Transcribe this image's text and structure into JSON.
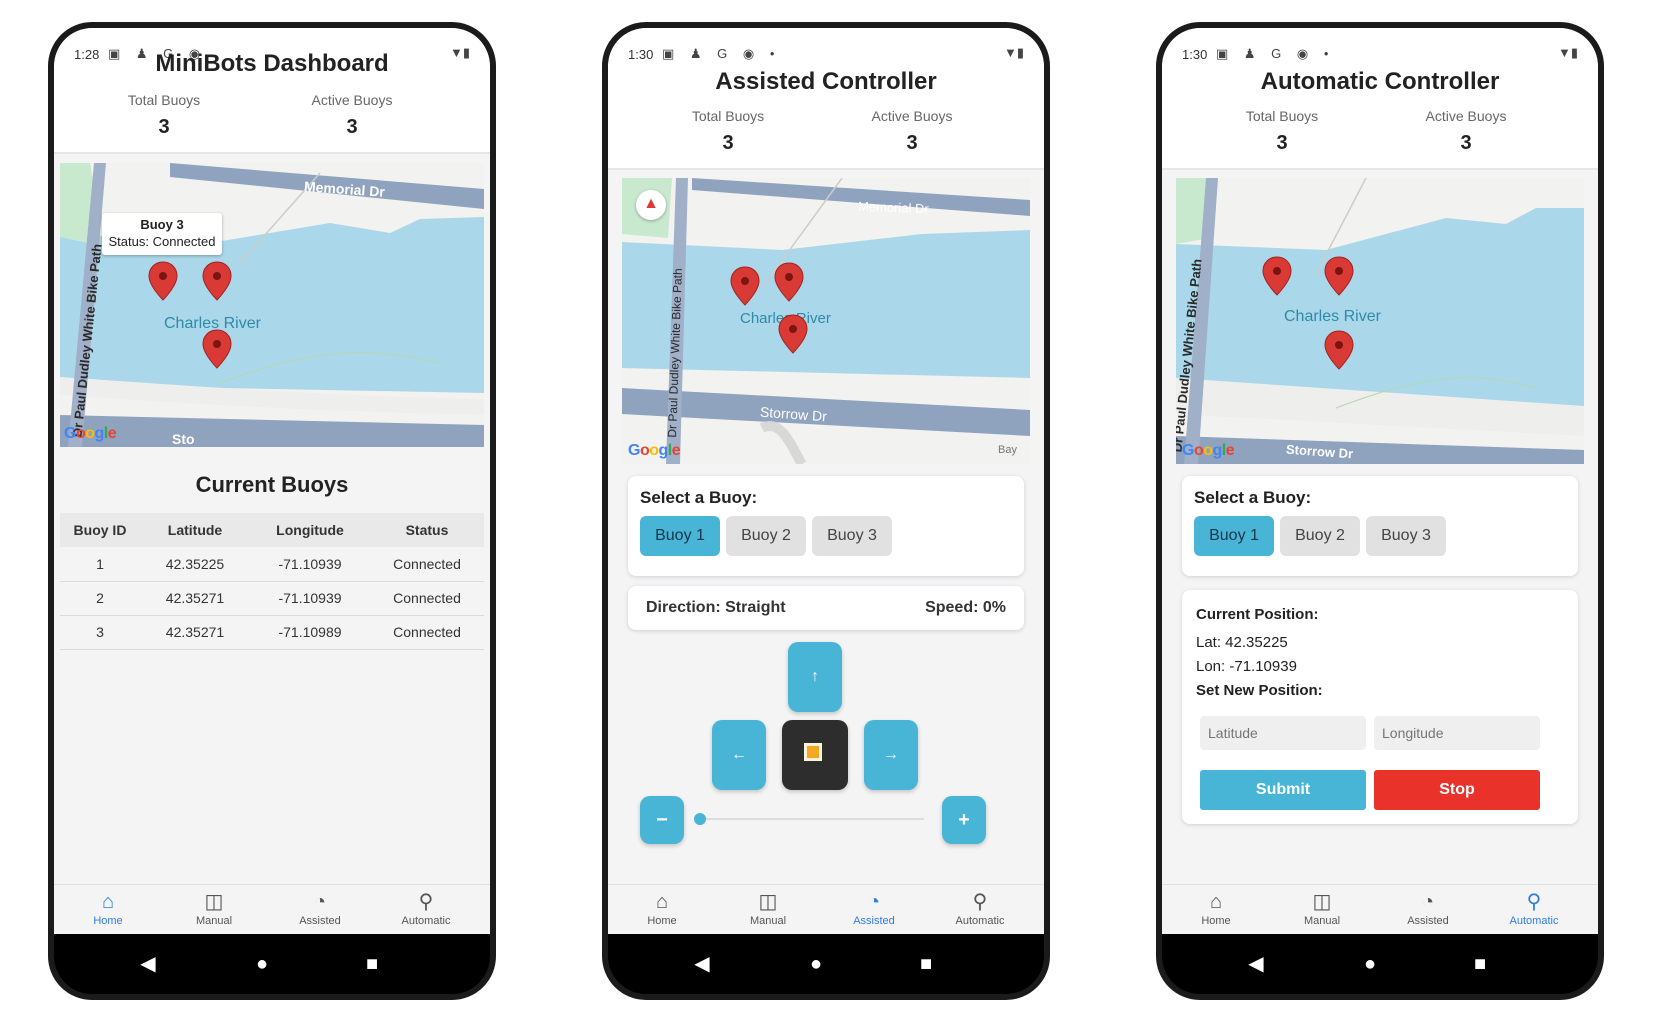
{
  "status_time": [
    "1:28",
    "1:30",
    "1:30"
  ],
  "screens": {
    "dashboard": {
      "title": "MiniBots Dashboard",
      "stats": {
        "total_label": "Total Buoys",
        "total_value": "3",
        "active_label": "Active Buoys",
        "active_value": "3"
      },
      "map": {
        "road_top": "Memorial Dr",
        "road_left": "Dr Paul Dudley White Bike Path",
        "river": "Charles River",
        "road_bottom": "Sto",
        "google": "Google",
        "tooltip_title": "Buoy 3",
        "tooltip_status": "Status: Connected"
      },
      "table_title": "Current Buoys",
      "table": {
        "headers": [
          "Buoy ID",
          "Latitude",
          "Longitude",
          "Status"
        ],
        "rows": [
          [
            "1",
            "42.35225",
            "-71.10939",
            "Connected"
          ],
          [
            "2",
            "42.35271",
            "-71.10939",
            "Connected"
          ],
          [
            "3",
            "42.35271",
            "-71.10989",
            "Connected"
          ]
        ]
      }
    },
    "assisted": {
      "title": "Assisted Controller",
      "stats": {
        "total_label": "Total Buoys",
        "total_value": "3",
        "active_label": "Active Buoys",
        "active_value": "3"
      },
      "map": {
        "road_top": "Memorial Dr",
        "road_left": "Dr Paul Dudley White Bike Path",
        "river": "Charles River",
        "road_bottom": "Storrow Dr",
        "bay": "Bay",
        "google": "Google"
      },
      "select_label": "Select a Buoy:",
      "buoys": [
        "Buoy 1",
        "Buoy 2",
        "Buoy 3"
      ],
      "direction": "Direction: Straight",
      "speed": "Speed: 0%",
      "speed_fraction": 0,
      "controls": {
        "up": "↑",
        "left": "←",
        "right": "→",
        "minus": "−",
        "plus": "+"
      }
    },
    "automatic": {
      "title": "Automatic Controller",
      "stats": {
        "total_label": "Total Buoys",
        "total_value": "3",
        "active_label": "Active Buoys",
        "active_value": "3"
      },
      "map": {
        "road_left": "Dr Paul Dudley White Bike Path",
        "river": "Charles River",
        "road_bottom": "Storrow Dr",
        "google": "Google"
      },
      "select_label": "Select a Buoy:",
      "buoys": [
        "Buoy 1",
        "Buoy 2",
        "Buoy 3"
      ],
      "current_position_label": "Current Position:",
      "lat": "Lat: 42.35225",
      "lon": "Lon: -71.10939",
      "set_position_label": "Set New Position:",
      "lat_placeholder": "Latitude",
      "lon_placeholder": "Longitude",
      "submit": "Submit",
      "stop": "Stop"
    }
  },
  "nav": [
    "Home",
    "Manual",
    "Assisted",
    "Automatic"
  ],
  "nav_active": [
    "Home",
    "Assisted",
    "Automatic"
  ],
  "colors": {
    "accent": "#48b4d6",
    "nav_active": "#2f7de1",
    "stop": "#e8322a",
    "water": "#aad8ea",
    "road": "#8fa2be",
    "pin": "#d93a35"
  }
}
